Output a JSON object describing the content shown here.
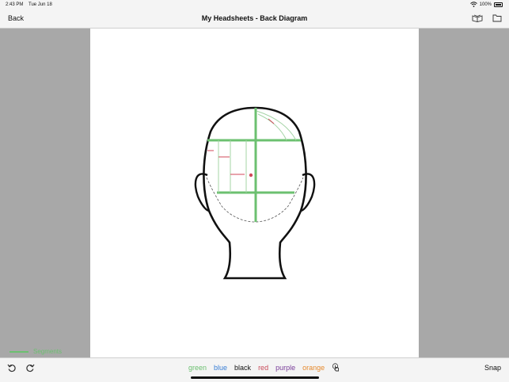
{
  "status": {
    "time": "2:43 PM",
    "date": "Tue Jun 18",
    "battery": "100%"
  },
  "nav": {
    "back_label": "Back",
    "title": "My Headsheets - Back Diagram",
    "icons": [
      "book-icon",
      "folder-icon"
    ]
  },
  "legend": {
    "label": "Segments",
    "color": "#6cc070"
  },
  "toolbar": {
    "colors": [
      {
        "label": "green",
        "color": "#6cc070"
      },
      {
        "label": "blue",
        "color": "#3a7fd5"
      },
      {
        "label": "black",
        "color": "#111111"
      },
      {
        "label": "red",
        "color": "#c94b5a"
      },
      {
        "label": "purple",
        "color": "#7a3f9a"
      },
      {
        "label": "orange",
        "color": "#e68a2e"
      }
    ],
    "snap_label": "Snap"
  },
  "drawing": {
    "segment_color": "#6cc070",
    "guide_color": "#a4d4a6",
    "mark_color": "#d04a5a"
  }
}
